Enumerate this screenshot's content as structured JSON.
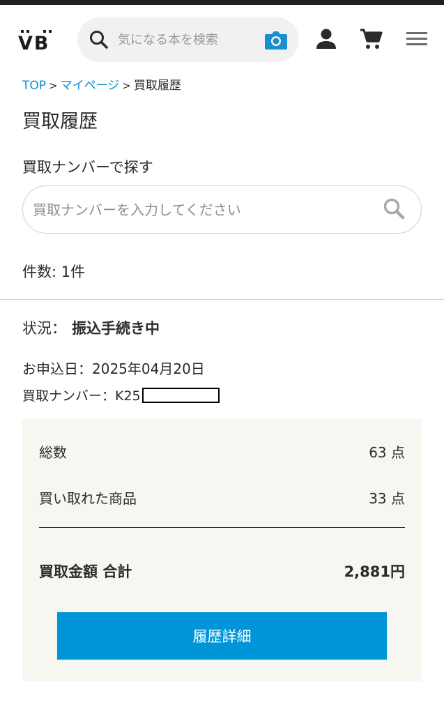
{
  "header": {
    "logo_text": "VB",
    "search_placeholder": "気になる本を検索"
  },
  "breadcrumb": {
    "items": [
      {
        "label": "TOP"
      },
      {
        "label": "マイページ"
      },
      {
        "label": "買取履歴"
      }
    ],
    "separator": ">"
  },
  "page": {
    "title": "買取履歴",
    "search_label": "買取ナンバーで探す",
    "search_placeholder": "買取ナンバーを入力してください",
    "count_text": "件数: 1件"
  },
  "record": {
    "status_label": "状況：",
    "status_value": "振込手続き中",
    "apply_date_text": "お申込日：2025年04月20日",
    "number_label": "買取ナンバー：K25"
  },
  "summary": {
    "total_label": "総数",
    "total_value": "63 点",
    "bought_label": "買い取れた商品",
    "bought_value": "33 点",
    "amount_label": "買取金額 合計",
    "amount_value": "2,881円",
    "detail_button": "履歴詳細"
  },
  "colors": {
    "accent": "#0095d9",
    "link": "#0a8fd1",
    "summary_bg": "#f8f6f1",
    "camera_icon": "#1a8fd0"
  },
  "icons": [
    "search-icon",
    "camera-icon",
    "user-icon",
    "cart-icon",
    "menu-icon"
  ]
}
